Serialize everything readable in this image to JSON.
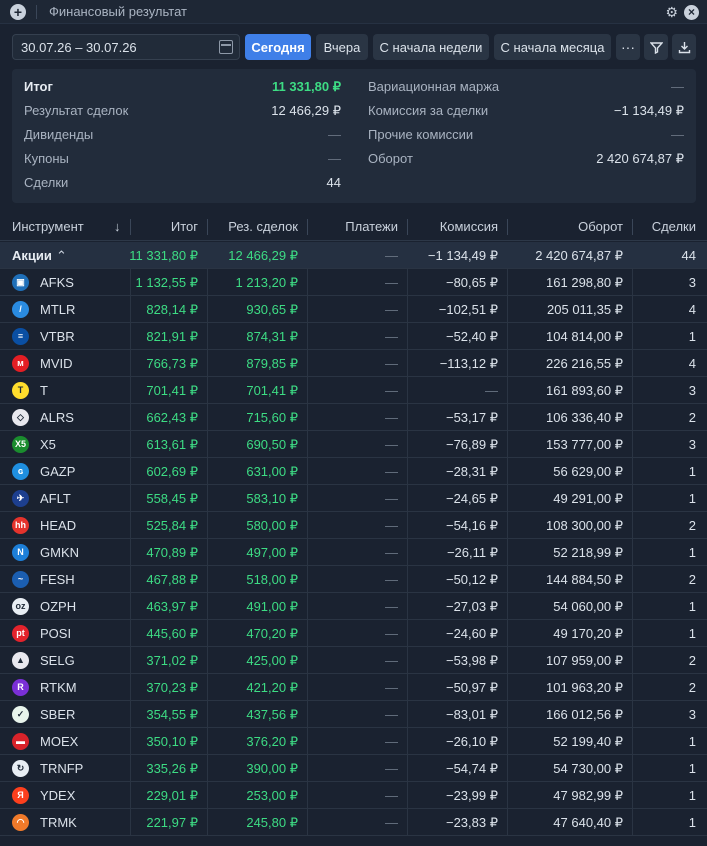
{
  "window": {
    "title": "Финансовый результат"
  },
  "toolbar": {
    "date_range": "30.07.26 – 30.07.26",
    "buttons": [
      "Сегодня",
      "Вчера",
      "С начала недели",
      "С начала месяца"
    ],
    "more_label": "···"
  },
  "summary": {
    "left": [
      {
        "label": "Итог",
        "value": "11 331,80 ₽"
      },
      {
        "label": "Результат сделок",
        "value": "12 466,29 ₽"
      },
      {
        "label": "Дивиденды",
        "value": "—"
      },
      {
        "label": "Купоны",
        "value": "—"
      },
      {
        "label": "Сделки",
        "value": "44"
      }
    ],
    "right": [
      {
        "label": "Вариационная маржа",
        "value": "—"
      },
      {
        "label": "Комиссия за сделки",
        "value": "−1 134,49 ₽"
      },
      {
        "label": "Прочие комиссии",
        "value": "—"
      },
      {
        "label": "Оборот",
        "value": "2 420 674,87 ₽"
      }
    ]
  },
  "table": {
    "headers": {
      "instrument": "Инструмент",
      "sort": "↓",
      "total": "Итог",
      "deals_result": "Рез. сделок",
      "payments": "Платежи",
      "commission": "Комиссия",
      "turnover": "Оборот",
      "deals": "Сделки"
    },
    "group": {
      "name": "Акции",
      "total": "11 331,80 ₽",
      "deals_result": "12 466,29 ₽",
      "payments": "—",
      "commission": "−1 134,49 ₽",
      "turnover": "2 420 674,87 ₽",
      "deals": "44"
    },
    "rows": [
      {
        "ticker": "AFKS",
        "logo_color": "#1f6fb8",
        "logo_text": "▣",
        "total": "1 132,55 ₽",
        "deals_result": "1 213,20 ₽",
        "payments": "—",
        "commission": "−80,65 ₽",
        "turnover": "161 298,80 ₽",
        "deals": "3"
      },
      {
        "ticker": "MTLR",
        "logo_color": "#2a8be0",
        "logo_text": "/",
        "total": "828,14 ₽",
        "deals_result": "930,65 ₽",
        "payments": "—",
        "commission": "−102,51 ₽",
        "turnover": "205 011,35 ₽",
        "deals": "4"
      },
      {
        "ticker": "VTBR",
        "logo_color": "#0a4fa3",
        "logo_text": "≡",
        "total": "821,91 ₽",
        "deals_result": "874,31 ₽",
        "payments": "—",
        "commission": "−52,40 ₽",
        "turnover": "104 814,00 ₽",
        "deals": "1"
      },
      {
        "ticker": "MVID",
        "logo_color": "#e31e24",
        "logo_text": "м",
        "total": "766,73 ₽",
        "deals_result": "879,85 ₽",
        "payments": "—",
        "commission": "−113,12 ₽",
        "turnover": "226 216,55 ₽",
        "deals": "4"
      },
      {
        "ticker": "T",
        "logo_color": "#ffdd2d",
        "logo_text": "T",
        "total": "701,41 ₽",
        "deals_result": "701,41 ₽",
        "payments": "—",
        "commission": "—",
        "turnover": "161 893,60 ₽",
        "deals": "3"
      },
      {
        "ticker": "ALRS",
        "logo_color": "#e8e8ee",
        "logo_text": "◇",
        "total": "662,43 ₽",
        "deals_result": "715,60 ₽",
        "payments": "—",
        "commission": "−53,17 ₽",
        "turnover": "106 336,40 ₽",
        "deals": "2"
      },
      {
        "ticker": "X5",
        "logo_color": "#1a8c2e",
        "logo_text": "X5",
        "total": "613,61 ₽",
        "deals_result": "690,50 ₽",
        "payments": "—",
        "commission": "−76,89 ₽",
        "turnover": "153 777,00 ₽",
        "deals": "3"
      },
      {
        "ticker": "GAZP",
        "logo_color": "#1f8fe0",
        "logo_text": "ɢ",
        "total": "602,69 ₽",
        "deals_result": "631,00 ₽",
        "payments": "—",
        "commission": "−28,31 ₽",
        "turnover": "56 629,00 ₽",
        "deals": "1"
      },
      {
        "ticker": "AFLT",
        "logo_color": "#1d3f8f",
        "logo_text": "✈",
        "total": "558,45 ₽",
        "deals_result": "583,10 ₽",
        "payments": "—",
        "commission": "−24,65 ₽",
        "turnover": "49 291,00 ₽",
        "deals": "1"
      },
      {
        "ticker": "HEAD",
        "logo_color": "#e4332c",
        "logo_text": "hh",
        "total": "525,84 ₽",
        "deals_result": "580,00 ₽",
        "payments": "—",
        "commission": "−54,16 ₽",
        "turnover": "108 300,00 ₽",
        "deals": "2"
      },
      {
        "ticker": "GMKN",
        "logo_color": "#1d7fd8",
        "logo_text": "N",
        "total": "470,89 ₽",
        "deals_result": "497,00 ₽",
        "payments": "—",
        "commission": "−26,11 ₽",
        "turnover": "52 218,99 ₽",
        "deals": "1"
      },
      {
        "ticker": "FESH",
        "logo_color": "#1b5eb0",
        "logo_text": "~",
        "total": "467,88 ₽",
        "deals_result": "518,00 ₽",
        "payments": "—",
        "commission": "−50,12 ₽",
        "turnover": "144 884,50 ₽",
        "deals": "2"
      },
      {
        "ticker": "OZPH",
        "logo_color": "#e8eef4",
        "logo_text": "oz",
        "total": "463,97 ₽",
        "deals_result": "491,00 ₽",
        "payments": "—",
        "commission": "−27,03 ₽",
        "turnover": "54 060,00 ₽",
        "deals": "1"
      },
      {
        "ticker": "POSI",
        "logo_color": "#e3232c",
        "logo_text": "pt",
        "total": "445,60 ₽",
        "deals_result": "470,20 ₽",
        "payments": "—",
        "commission": "−24,60 ₽",
        "turnover": "49 170,20 ₽",
        "deals": "1"
      },
      {
        "ticker": "SELG",
        "logo_color": "#e8e8ee",
        "logo_text": "▲",
        "total": "371,02 ₽",
        "deals_result": "425,00 ₽",
        "payments": "—",
        "commission": "−53,98 ₽",
        "turnover": "107 959,00 ₽",
        "deals": "2"
      },
      {
        "ticker": "RTKM",
        "logo_color": "#7a2fd6",
        "logo_text": "R",
        "total": "370,23 ₽",
        "deals_result": "421,20 ₽",
        "payments": "—",
        "commission": "−50,97 ₽",
        "turnover": "101 963,20 ₽",
        "deals": "2"
      },
      {
        "ticker": "SBER",
        "logo_color": "#e8f4ec",
        "logo_text": "✓",
        "total": "354,55 ₽",
        "deals_result": "437,56 ₽",
        "payments": "—",
        "commission": "−83,01 ₽",
        "turnover": "166 012,56 ₽",
        "deals": "3"
      },
      {
        "ticker": "MOEX",
        "logo_color": "#d8232a",
        "logo_text": "▬",
        "total": "350,10 ₽",
        "deals_result": "376,20 ₽",
        "payments": "—",
        "commission": "−26,10 ₽",
        "turnover": "52 199,40 ₽",
        "deals": "1"
      },
      {
        "ticker": "TRNFP",
        "logo_color": "#e8eef4",
        "logo_text": "↻",
        "total": "335,26 ₽",
        "deals_result": "390,00 ₽",
        "payments": "—",
        "commission": "−54,74 ₽",
        "turnover": "54 730,00 ₽",
        "deals": "1"
      },
      {
        "ticker": "YDEX",
        "logo_color": "#fc3f1d",
        "logo_text": "Я",
        "total": "229,01 ₽",
        "deals_result": "253,00 ₽",
        "payments": "—",
        "commission": "−23,99 ₽",
        "turnover": "47 982,99 ₽",
        "deals": "1"
      },
      {
        "ticker": "TRMK",
        "logo_color": "#f07a2a",
        "logo_text": "◠",
        "total": "221,97 ₽",
        "deals_result": "245,80 ₽",
        "payments": "—",
        "commission": "−23,83 ₽",
        "turnover": "47 640,40 ₽",
        "deals": "1"
      }
    ]
  },
  "colors": {
    "accent": "#3f7fe8",
    "positive": "#3ddc84",
    "background": "#1a2230"
  }
}
